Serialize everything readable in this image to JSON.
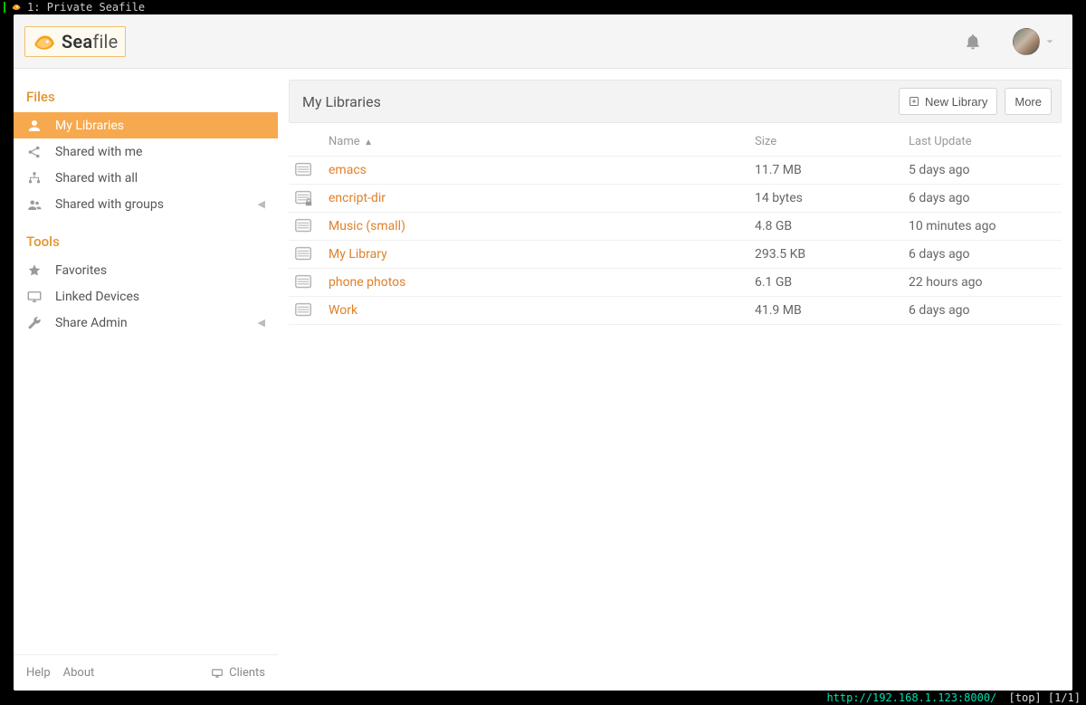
{
  "window": {
    "tab_index": "1:",
    "tab_title": "Private Seafile"
  },
  "brand": {
    "name_strong": "Sea",
    "name_light": "file"
  },
  "sidebar": {
    "sections": {
      "files": {
        "heading": "Files",
        "items": [
          {
            "label": "My Libraries",
            "active": true
          },
          {
            "label": "Shared with me"
          },
          {
            "label": "Shared with all"
          },
          {
            "label": "Shared with groups",
            "expandable": true
          }
        ]
      },
      "tools": {
        "heading": "Tools",
        "items": [
          {
            "label": "Favorites"
          },
          {
            "label": "Linked Devices"
          },
          {
            "label": "Share Admin",
            "expandable": true
          }
        ]
      }
    },
    "footer": {
      "help": "Help",
      "about": "About",
      "clients": "Clients"
    }
  },
  "panel": {
    "title": "My Libraries",
    "new_library": "New Library",
    "more": "More",
    "columns": {
      "name": "Name",
      "size": "Size",
      "last_update": "Last Update"
    },
    "rows": [
      {
        "name": "emacs",
        "size": "11.7 MB",
        "updated": "5 days ago",
        "encrypted": false
      },
      {
        "name": "encript-dir",
        "size": "14 bytes",
        "updated": "6 days ago",
        "encrypted": true
      },
      {
        "name": "Music (small)",
        "size": "4.8 GB",
        "updated": "10 minutes ago",
        "encrypted": false
      },
      {
        "name": "My Library",
        "size": "293.5 KB",
        "updated": "6 days ago",
        "encrypted": false
      },
      {
        "name": "phone photos",
        "size": "6.1 GB",
        "updated": "22 hours ago",
        "encrypted": false
      },
      {
        "name": "Work",
        "size": "41.9 MB",
        "updated": "6 days ago",
        "encrypted": false
      }
    ]
  },
  "status": {
    "url": "http://192.168.1.123:8000/",
    "pos": "[top] [1/1]"
  }
}
